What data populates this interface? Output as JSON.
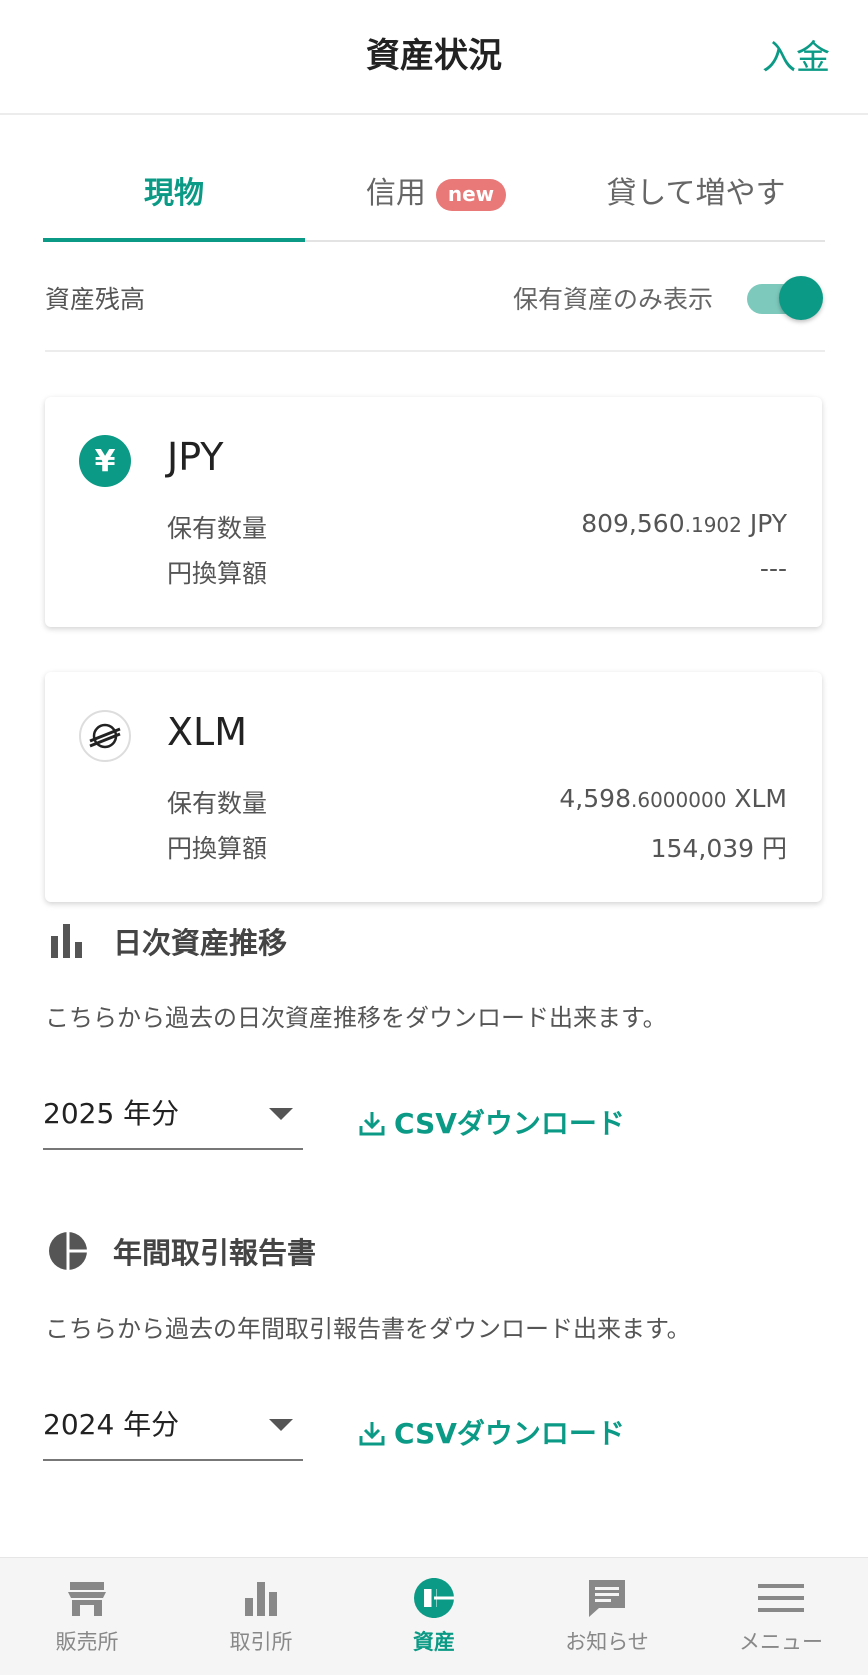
{
  "header": {
    "title": "資産状況",
    "deposit_label": "入金"
  },
  "tabs": [
    {
      "label": "現物",
      "active": true
    },
    {
      "label": "信用",
      "badge": "new"
    },
    {
      "label": "貸して増やす"
    }
  ],
  "balance": {
    "label": "資産残高",
    "toggle_label": "保有資産のみ表示",
    "toggle_on": true
  },
  "assets": [
    {
      "name": "JPY",
      "icon": "yen-icon",
      "qty_label": "保有数量",
      "qty_int": "809,560",
      "qty_dec": ".1902",
      "qty_unit": " JPY",
      "jpy_label": "円換算額",
      "jpy_value": "---"
    },
    {
      "name": "XLM",
      "icon": "stellar-icon",
      "qty_label": "保有数量",
      "qty_int": "4,598",
      "qty_dec": ".6000000",
      "qty_unit": " XLM",
      "jpy_label": "円換算額",
      "jpy_value": "154,039 円"
    }
  ],
  "daily": {
    "title": "日次資産推移",
    "desc": "こちらから過去の日次資産推移をダウンロード出来ます。",
    "year": "2025 年分",
    "csv_label": "CSVダウンロード"
  },
  "annual": {
    "title": "年間取引報告書",
    "desc": "こちらから過去の年間取引報告書をダウンロード出来ます。",
    "year": "2024 年分",
    "csv_label": "CSVダウンロード"
  },
  "nav": [
    {
      "label": "販売所",
      "icon": "store-icon"
    },
    {
      "label": "取引所",
      "icon": "bar-chart-icon"
    },
    {
      "label": "資産",
      "icon": "pie-chart-icon",
      "active": true
    },
    {
      "label": "お知らせ",
      "icon": "message-icon"
    },
    {
      "label": "メニュー",
      "icon": "menu-icon"
    }
  ],
  "colors": {
    "accent": "#0b9a85",
    "badge": "#e97979"
  }
}
